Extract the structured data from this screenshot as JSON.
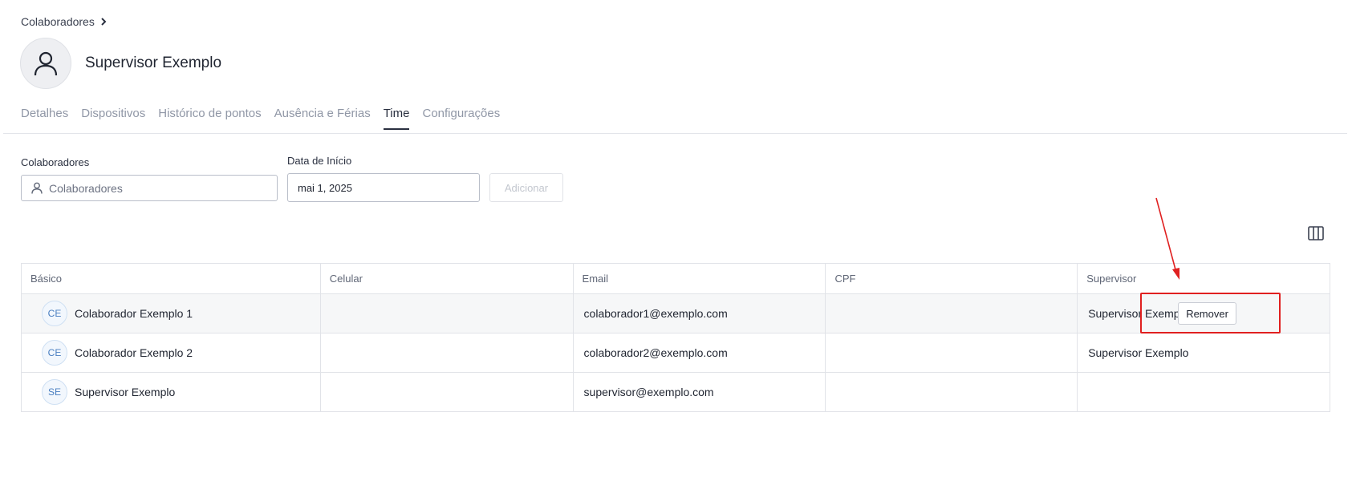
{
  "breadcrumb": {
    "label": "Colaboradores"
  },
  "header": {
    "title": "Supervisor Exemplo"
  },
  "tabs": [
    {
      "label": "Detalhes",
      "active": false
    },
    {
      "label": "Dispositivos",
      "active": false
    },
    {
      "label": "Histórico de pontos",
      "active": false
    },
    {
      "label": "Ausência e Férias",
      "active": false
    },
    {
      "label": "Time",
      "active": true
    },
    {
      "label": "Configurações",
      "active": false
    }
  ],
  "form": {
    "collaborators_label": "Colaboradores",
    "collaborators_placeholder": "Colaboradores",
    "start_date_label": "Data de Início",
    "start_date_value": "mai 1, 2025",
    "add_label": "Adicionar"
  },
  "table": {
    "headers": [
      "Básico",
      "Celular",
      "Email",
      "CPF",
      "Supervisor"
    ],
    "rows": [
      {
        "initials": "CE",
        "name": "Colaborador Exemplo 1",
        "phone": "",
        "email": "colaborador1@exemplo.com",
        "cpf": "",
        "supervisor": "Supervisor Exemplo",
        "action": "Remover"
      },
      {
        "initials": "CE",
        "name": "Colaborador Exemplo 2",
        "phone": "",
        "email": "colaborador2@exemplo.com",
        "cpf": "",
        "supervisor": "Supervisor Exemplo"
      },
      {
        "initials": "SE",
        "name": "Supervisor Exemplo",
        "phone": "",
        "email": "supervisor@exemplo.com",
        "cpf": "",
        "supervisor": ""
      }
    ]
  },
  "colors": {
    "annotation": "#e02020",
    "accent": "#2a3040",
    "initials": "#4a7fc1"
  }
}
